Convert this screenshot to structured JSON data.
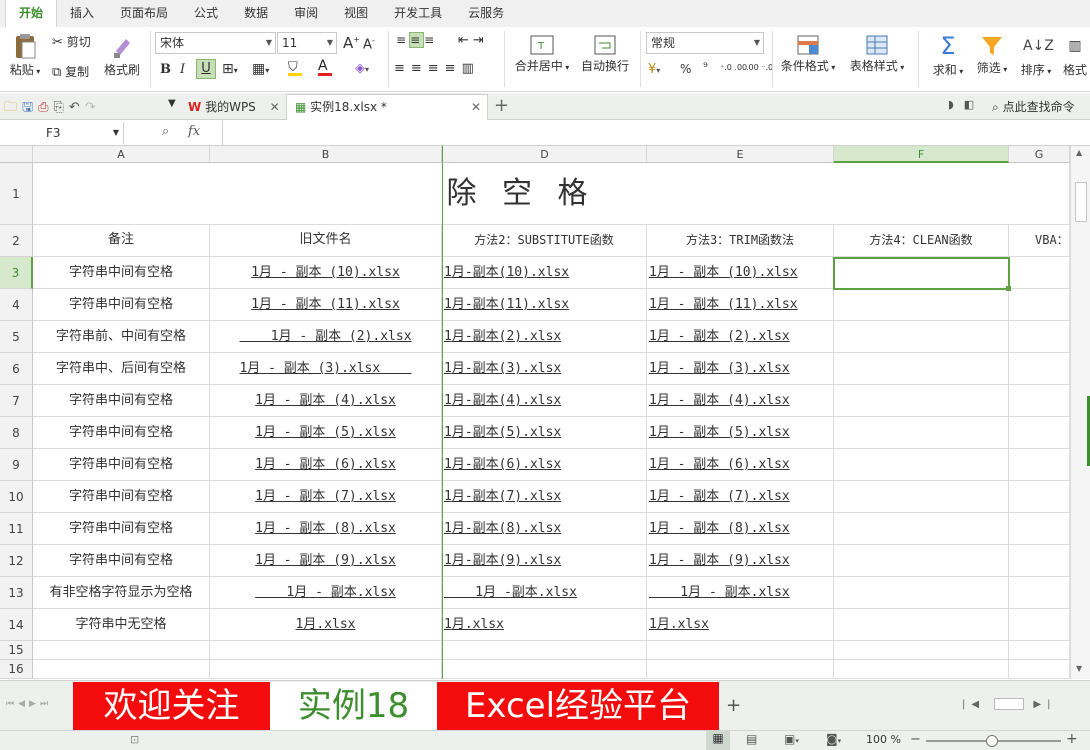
{
  "ribbon_tabs": [
    "开始",
    "插入",
    "页面布局",
    "公式",
    "数据",
    "审阅",
    "视图",
    "开发工具",
    "云服务"
  ],
  "ribbon": {
    "paste": "粘贴",
    "cut": "剪切",
    "copy": "复制",
    "format_painter": "格式刷",
    "font_name": "宋体",
    "font_size": "11",
    "merge_center": "合并居中",
    "wrap_text": "自动换行",
    "number_format": "常规",
    "conditional_format": "条件格式",
    "table_style": "表格样式",
    "sum": "求和",
    "filter": "筛选",
    "sort": "排序",
    "format": "格式",
    "bold": "B",
    "italic": "I",
    "underline": "U",
    "percent": "%",
    "thousands": "⁹",
    "inc_decimal": "⁺.0 .00",
    "dec_decimal": ".00 ⁻.0"
  },
  "doc_tabs": {
    "home": "我的WPS",
    "file": "实例18.xlsx *",
    "search": "点此查找命令"
  },
  "formula_bar": {
    "name_box": "F3",
    "fx": "fx",
    "value": ""
  },
  "columns": [
    "A",
    "B",
    "D",
    "E",
    "F",
    "G"
  ],
  "title": "除 空 格",
  "headers": [
    "备注",
    "旧文件名",
    "方法2：SUBSTITUTE函数",
    "方法3：TRIM函数法",
    "方法4：CLEAN函数",
    "VBA："
  ],
  "rows": [
    {
      "num": "3",
      "note": "字符串中间有空格",
      "old": "1月 - 副本 (10).xlsx",
      "m2": "1月-副本(10).xlsx",
      "m3": "1月 - 副本 (10).xlsx"
    },
    {
      "num": "4",
      "note": "字符串中间有空格",
      "old": "1月 - 副本 (11).xlsx",
      "m2": "1月-副本(11).xlsx",
      "m3": "1月 - 副本 (11).xlsx"
    },
    {
      "num": "5",
      "note": "字符串前、中间有空格",
      "old": "    1月 - 副本 (2).xlsx",
      "m2": "1月-副本(2).xlsx",
      "m3": "1月 - 副本 (2).xlsx"
    },
    {
      "num": "6",
      "note": "字符串中、后间有空格",
      "old": "1月 - 副本 (3).xlsx    ",
      "m2": "1月-副本(3).xlsx",
      "m3": "1月 - 副本 (3).xlsx"
    },
    {
      "num": "7",
      "note": "字符串中间有空格",
      "old": "1月 - 副本 (4).xlsx",
      "m2": "1月-副本(4).xlsx",
      "m3": "1月 - 副本 (4).xlsx"
    },
    {
      "num": "8",
      "note": "字符串中间有空格",
      "old": "1月 - 副本 (5).xlsx",
      "m2": "1月-副本(5).xlsx",
      "m3": "1月 - 副本 (5).xlsx"
    },
    {
      "num": "9",
      "note": "字符串中间有空格",
      "old": "1月 - 副本 (6).xlsx",
      "m2": "1月-副本(6).xlsx",
      "m3": "1月 - 副本 (6).xlsx"
    },
    {
      "num": "10",
      "note": "字符串中间有空格",
      "old": "1月 - 副本 (7).xlsx",
      "m2": "1月-副本(7).xlsx",
      "m3": "1月 - 副本 (7).xlsx"
    },
    {
      "num": "11",
      "note": "字符串中间有空格",
      "old": "1月 - 副本 (8).xlsx",
      "m2": "1月-副本(8).xlsx",
      "m3": "1月 - 副本 (8).xlsx"
    },
    {
      "num": "12",
      "note": "字符串中间有空格",
      "old": "1月 - 副本 (9).xlsx",
      "m2": "1月-副本(9).xlsx",
      "m3": "1月 - 副本 (9).xlsx"
    },
    {
      "num": "13",
      "note": "有非空格字符显示为空格",
      "old": "    1月 - 副本.xlsx",
      "m2": "    1月 -副本.xlsx",
      "m3": "    1月 - 副本.xlsx"
    },
    {
      "num": "14",
      "note": "字符串中无空格",
      "old": "1月.xlsx",
      "m2": "1月.xlsx",
      "m3": "1月.xlsx"
    }
  ],
  "extra_rows": [
    "15",
    "16"
  ],
  "sheet_tabs": [
    "欢迎关注",
    "实例18",
    "Excel经验平台"
  ],
  "add_sheet": "+",
  "status": {
    "zoom": "100 %"
  },
  "colors": {
    "accent": "#3d8e2e",
    "red_tab": "#f40c0c",
    "selection": "#5ea343"
  }
}
